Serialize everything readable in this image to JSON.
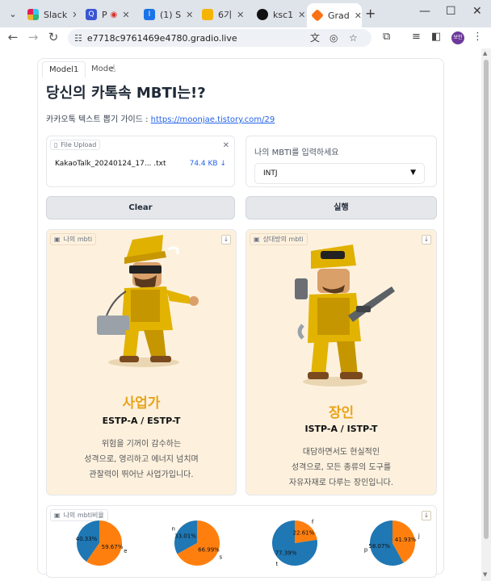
{
  "browser": {
    "tabs": [
      {
        "label": "Slack",
        "favicon_color": "#4a154b",
        "fav_glyph": "",
        "active": false
      },
      {
        "label": "P",
        "favicon_color": "#3a56d4",
        "fav_glyph": "Q",
        "active": false
      },
      {
        "label": "(1) S",
        "favicon_color": "#1a73e8",
        "fav_glyph": "I",
        "active": false
      },
      {
        "label": "6기",
        "favicon_color": "#f4b400",
        "fav_glyph": "",
        "active": false
      },
      {
        "label": "ksc1",
        "favicon_color": "#111111",
        "fav_glyph": "",
        "active": false
      },
      {
        "label": "Grad",
        "favicon_color": "#f97316",
        "fav_glyph": "",
        "active": true
      }
    ],
    "url": "e7718c9761469e4780.gradio.live",
    "profile_label": "보인"
  },
  "app": {
    "tabs": [
      "Model1",
      "Mode"
    ],
    "title": "당신의 카톡속 MBTI는!?",
    "guide_prefix": "카카오톡 텍스트 뽑기 가이드 : ",
    "guide_link": "https://moonjae.tistory.com/29",
    "upload": {
      "label": "File Upload",
      "file_name": "KakaoTalk_20240124_17... .txt",
      "file_size": "74.4 KB ↓"
    },
    "select": {
      "label": "나의 MBTI를 입력하세요",
      "value": "INTJ"
    },
    "clear_label": "Clear",
    "run_label": "실행",
    "my_card": {
      "label": "나의 mbti",
      "type_name": "사업가",
      "code": "ESTP-A / ESTP-T",
      "desc": [
        "위험을 기꺼이 감수하는",
        "성격으로, 영리하고 에너지 넘치며",
        "관찰력이 뛰어난 사업가입니다."
      ]
    },
    "partner_card": {
      "label": "상대방의 mbti",
      "type_name": "장인",
      "code": "ISTP-A / ISTP-T",
      "desc": [
        "대담하면서도 현실적인",
        "성격으로, 모든 종류의 도구를",
        "자유자재로 다루는 장인입니다."
      ]
    },
    "ratio_label": "나의 mbti비율"
  },
  "chart_data": [
    {
      "type": "pie",
      "title": "",
      "categories": [
        "",
        "e"
      ],
      "values": [
        40.33,
        59.67
      ],
      "labels": [
        "40.33%",
        "59.67%"
      ],
      "colors": [
        "#1f77b4",
        "#ff7f0e"
      ]
    },
    {
      "type": "pie",
      "title": "",
      "categories": [
        "n",
        "s"
      ],
      "values": [
        33.01,
        66.99
      ],
      "labels": [
        "33.01%",
        "66.99%"
      ],
      "colors": [
        "#1f77b4",
        "#ff7f0e"
      ]
    },
    {
      "type": "pie",
      "title": "",
      "categories": [
        "t",
        "f"
      ],
      "values": [
        77.39,
        22.61
      ],
      "labels": [
        "77.39%",
        "22.61%"
      ],
      "colors": [
        "#1f77b4",
        "#ff7f0e"
      ]
    },
    {
      "type": "pie",
      "title": "",
      "categories": [
        "p",
        "j"
      ],
      "values": [
        58.07,
        41.93
      ],
      "labels": [
        "58.07%",
        "41.93%"
      ],
      "colors": [
        "#1f77b4",
        "#ff7f0e"
      ]
    }
  ]
}
